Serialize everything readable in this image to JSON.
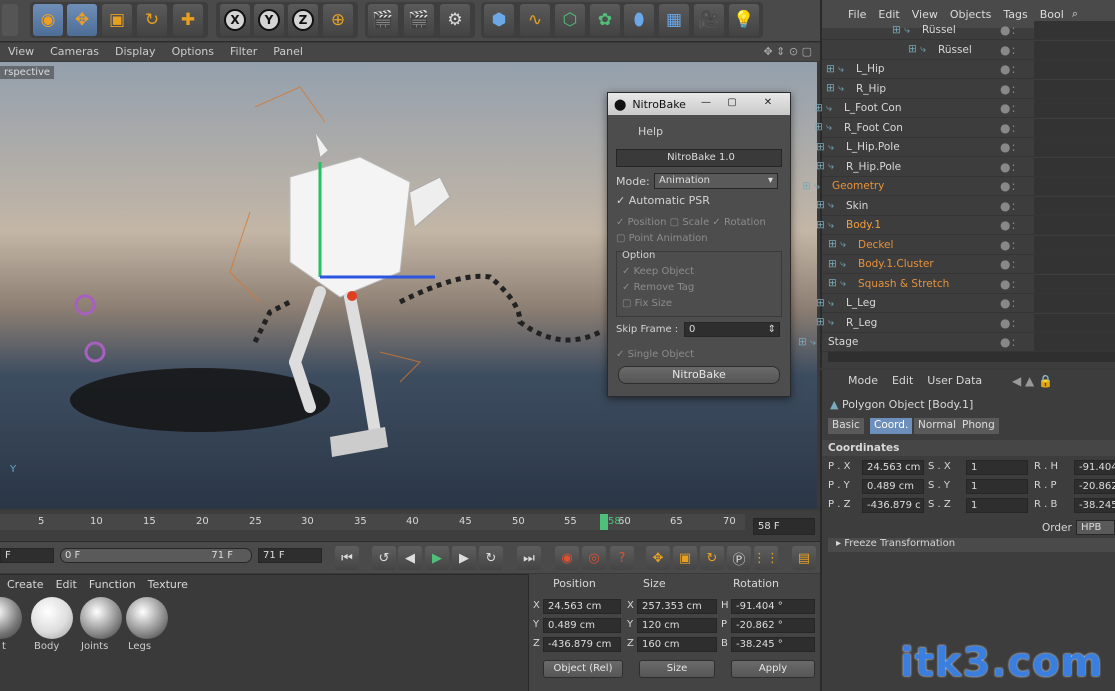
{
  "toolbar": {
    "axes": [
      "X",
      "Y",
      "Z"
    ]
  },
  "viewport_menu": [
    "View",
    "Cameras",
    "Display",
    "Options",
    "Filter",
    "Panel"
  ],
  "viewport": {
    "label": "rspective"
  },
  "nitrobake": {
    "title": "NitroBake",
    "menu": "Help",
    "version": "NitroBake 1.0",
    "mode_label": "Mode:",
    "mode_value": "Animation",
    "automatic_psr": "Automatic PSR",
    "position": "Position",
    "scale": "Scale",
    "rotation": "Rotation",
    "point_animation": "Point Animation",
    "option_label": "Option",
    "keep_object": "Keep Object",
    "remove_tag": "Remove Tag",
    "fix_size": "Fix Size",
    "skip_frame_label": "Skip Frame :",
    "skip_frame_value": "0",
    "single_object": "Single Object",
    "bake_button": "NitroBake"
  },
  "object_manager": {
    "menu": [
      "File",
      "Edit",
      "View",
      "Objects",
      "Tags",
      "Bool"
    ],
    "items": [
      {
        "name": "Rüssel",
        "color": "#d8d8d8"
      },
      {
        "name": "Rüssel",
        "color": "#d8d8d8"
      },
      {
        "name": "L_Hip",
        "color": "#d8d8d8"
      },
      {
        "name": "R_Hip",
        "color": "#d8d8d8"
      },
      {
        "name": "L_Foot Con",
        "color": "#d8d8d8"
      },
      {
        "name": "R_Foot Con",
        "color": "#d8d8d8"
      },
      {
        "name": "L_Hip.Pole",
        "color": "#d8d8d8"
      },
      {
        "name": "R_Hip.Pole",
        "color": "#d8d8d8"
      },
      {
        "name": "Geometry",
        "color": "#e8923a"
      },
      {
        "name": "Skin",
        "color": "#d8d8d8"
      },
      {
        "name": "Body.1",
        "color": "#f0a040"
      },
      {
        "name": "Deckel",
        "color": "#e8923a"
      },
      {
        "name": "Body.1.Cluster",
        "color": "#e8923a"
      },
      {
        "name": "Squash & Stretch",
        "color": "#e8923a"
      },
      {
        "name": "L_Leg",
        "color": "#d8d8d8"
      },
      {
        "name": "R_Leg",
        "color": "#d8d8d8"
      },
      {
        "name": "Stage",
        "color": "#d8d8d8"
      }
    ]
  },
  "attributes": {
    "menu": [
      "Mode",
      "Edit",
      "User Data"
    ],
    "object_title": "Polygon Object [Body.1]",
    "tabs": [
      "Basic",
      "Coord.",
      "Normal",
      "Phong"
    ],
    "section": "Coordinates",
    "px": "P . X",
    "px_val": "24.563 cm",
    "py": "P . Y",
    "py_val": "0.489 cm",
    "pz": "P . Z",
    "pz_val": "-436.879 c",
    "sx": "S . X",
    "sx_val": "1",
    "sy": "S . Y",
    "sy_val": "1",
    "sz": "S . Z",
    "sz_val": "1",
    "rh": "R . H",
    "rh_val": "-91.404",
    "rp": "R . P",
    "rp_val": "-20.862",
    "rb": "R . B",
    "rb_val": "-38.245",
    "order_label": "Order",
    "order_val": "HPB",
    "freeze": "Freeze Transformation"
  },
  "timeline": {
    "ticks": [
      "5",
      "10",
      "15",
      "20",
      "25",
      "30",
      "35",
      "40",
      "45",
      "50",
      "55",
      "58",
      "60",
      "65",
      "70"
    ],
    "current_frame": "58 F",
    "start": "F",
    "range_start": "0 F",
    "range_end": "71 F",
    "end": "71 F"
  },
  "material_manager": {
    "menu": [
      "Create",
      "Edit",
      "Function",
      "Texture"
    ],
    "materials": [
      "t",
      "Body",
      "Joints",
      "Legs"
    ]
  },
  "coordinates_panel": {
    "headers": [
      "Position",
      "Size",
      "Rotation"
    ],
    "rows": [
      {
        "axis": "X",
        "pos": "24.563 cm",
        "saxis": "X",
        "size": "257.353 cm",
        "raxis": "H",
        "rot": "-91.404 °"
      },
      {
        "axis": "Y",
        "pos": "0.489 cm",
        "saxis": "Y",
        "size": "120 cm",
        "raxis": "P",
        "rot": "-20.862 °"
      },
      {
        "axis": "Z",
        "pos": "-436.879 cm",
        "saxis": "Z",
        "size": "160 cm",
        "raxis": "B",
        "rot": "-38.245 °"
      }
    ],
    "mode_select": "Object (Rel)",
    "size_select": "Size",
    "apply": "Apply"
  },
  "watermark": "itk3.com"
}
